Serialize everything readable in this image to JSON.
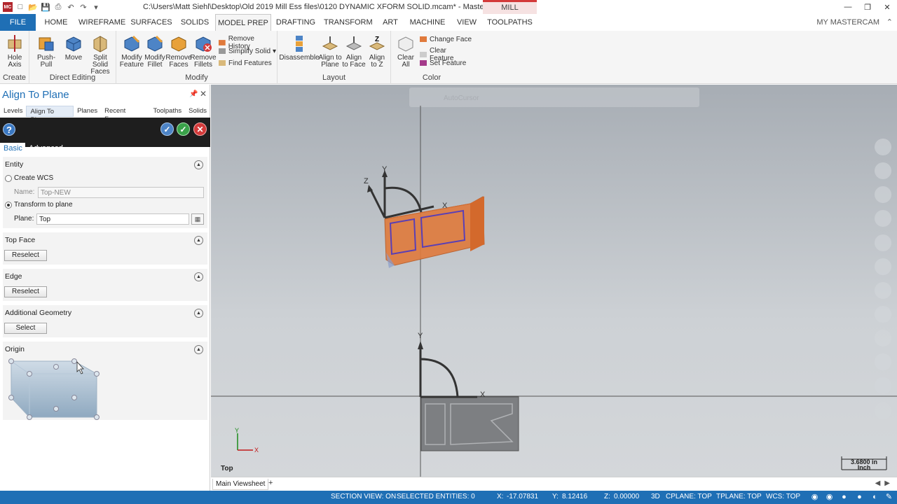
{
  "window": {
    "title": "C:\\Users\\Matt Siehl\\Desktop\\Old 2019 Mill Ess files\\0120 DYNAMIC XFORM SOLID.mcam* - Mastercam Mill 2019",
    "context_tab": "MILL"
  },
  "ribbon_tabs": [
    "FILE",
    "HOME",
    "WIREFRAME",
    "SURFACES",
    "SOLIDS",
    "MODEL PREP",
    "DRAFTING",
    "TRANSFORM",
    "ART",
    "MACHINE",
    "VIEW",
    "TOOLPATHS"
  ],
  "my_mastercam": "MY MASTERCAM",
  "ribbon": {
    "groups": {
      "create": "Create",
      "direct_editing": "Direct Editing",
      "modify": "Modify",
      "layout": "Layout",
      "color": "Color"
    },
    "buttons": {
      "hole_axis": [
        "Hole",
        "Axis"
      ],
      "push_pull": [
        "Push-Pull"
      ],
      "move": [
        "Move"
      ],
      "split_solid_faces": [
        "Split Solid",
        "Faces"
      ],
      "modify_feature": [
        "Modify",
        "Feature"
      ],
      "modify_fillet": [
        "Modify",
        "Fillet"
      ],
      "remove_faces": [
        "Remove",
        "Faces"
      ],
      "remove_fillets": [
        "Remove",
        "Fillets"
      ],
      "remove_history": "Remove History",
      "simplify_solid": "Simplify Solid",
      "find_features": "Find Features",
      "disassemble": [
        "Disassemble"
      ],
      "align_to_plane": [
        "Align to",
        "Plane"
      ],
      "align_to_face": [
        "Align",
        "to Face"
      ],
      "align_to_z": [
        "Align",
        "to Z"
      ],
      "clear_all": [
        "Clear",
        "All"
      ],
      "change_face": "Change Face",
      "clear_feature": "Clear Feature",
      "set_feature": "Set Feature"
    }
  },
  "panel": {
    "title": "Align To Plane",
    "tabs": [
      "Levels",
      "Align To Pla...",
      "Planes",
      "Recent Func...",
      "Toolpaths",
      "Solids"
    ],
    "subtabs": {
      "basic": "Basic",
      "advanced": "Advanced"
    },
    "entity": {
      "title": "Entity",
      "create_wcs": "Create WCS",
      "name_label": "Name:",
      "name_value": "Top-NEW",
      "transform_to_plane": "Transform to plane",
      "plane_label": "Plane:",
      "plane_value": "Top",
      "selected_option": "transform_to_plane"
    },
    "top_face": {
      "title": "Top Face",
      "button": "Reselect"
    },
    "edge": {
      "title": "Edge",
      "button": "Reselect"
    },
    "additional_geometry": {
      "title": "Additional Geometry",
      "button": "Select"
    },
    "origin": {
      "title": "Origin"
    }
  },
  "viewport": {
    "autocursor": "AutoCursor",
    "view_name": "Top",
    "scale_value": "3.6800 in",
    "scale_unit": "Inch",
    "axis_labels": {
      "x": "X",
      "y": "Y",
      "z": "Z"
    },
    "tab": "Main Viewsheet",
    "add_tab": "+"
  },
  "statusbar": {
    "section_view": "SECTION VIEW: ON",
    "selected_entities": "SELECTED ENTITIES: 0",
    "x_label": "X:",
    "x_value": "-17.07831",
    "y_label": "Y:",
    "y_value": "8.12416",
    "z_label": "Z:",
    "z_value": "0.00000",
    "mode": "3D",
    "cplane": "CPLANE: TOP",
    "tplane": "TPLANE: TOP",
    "wcs": "WCS: TOP"
  },
  "colors": {
    "accent_blue": "#1f6fb5",
    "part_orange": "#e07a3c",
    "part_grey": "#7d7f82"
  }
}
